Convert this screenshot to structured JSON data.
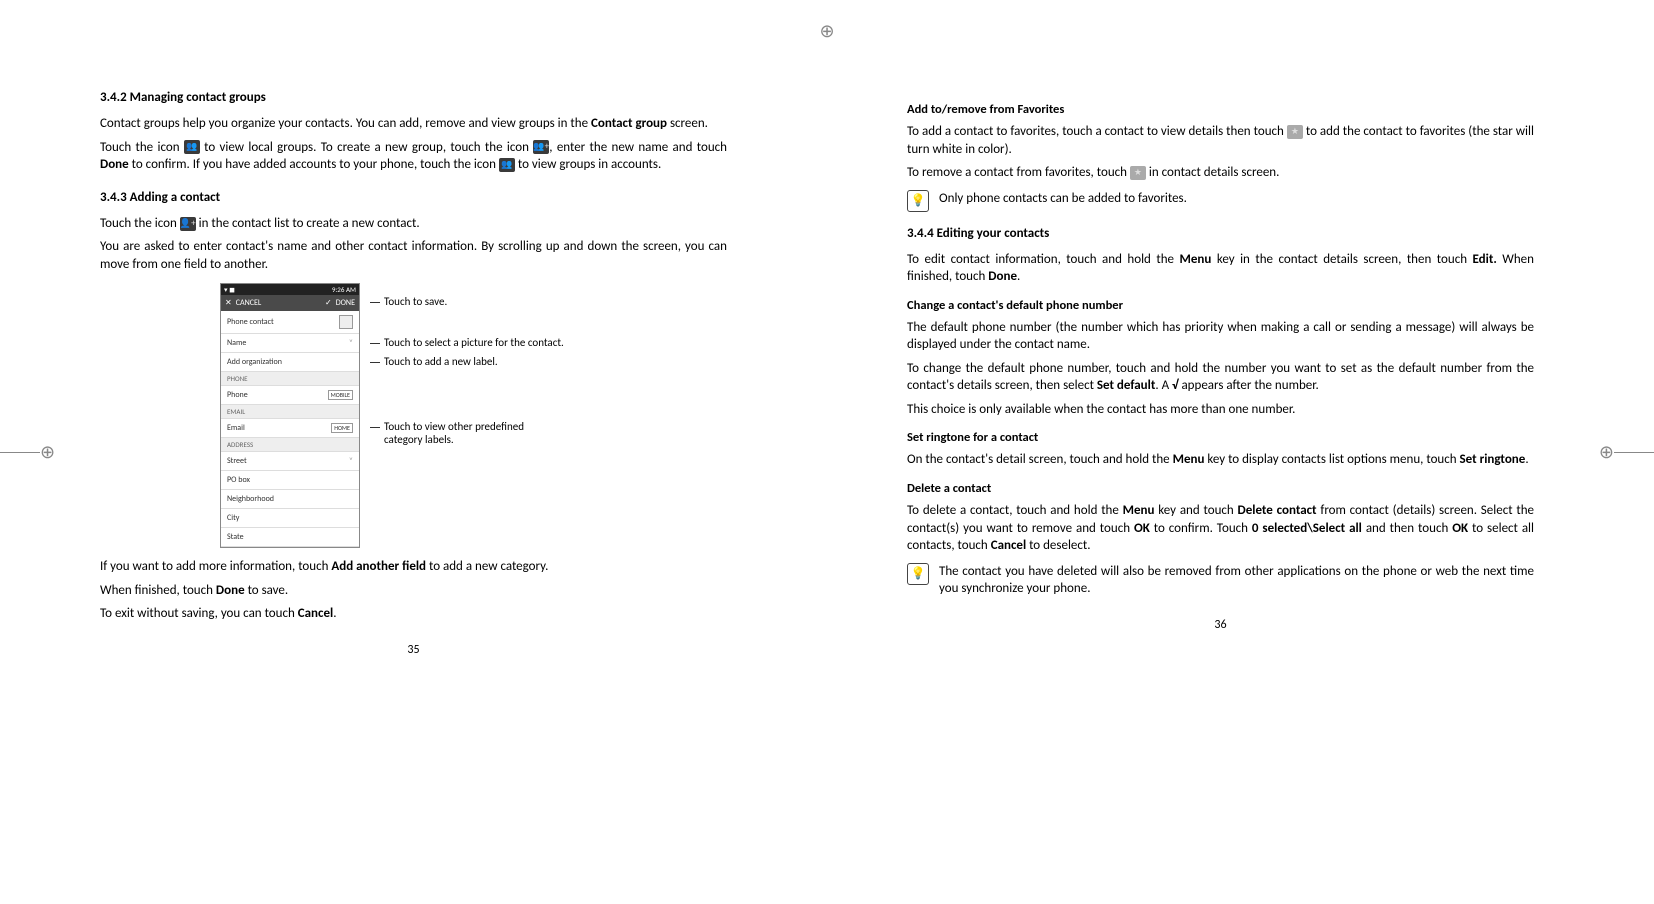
{
  "reg": {
    "top": "⊕",
    "bottom": "⊕",
    "left": "⊕",
    "right": "⊕"
  },
  "left": {
    "h342": "3.4.2   Managing contact groups",
    "p1a": "Contact groups help you organize your contacts. You can add, remove and view groups in the ",
    "p1b": "Contact group",
    "p1c": " screen.",
    "p2a": "Touch the icon ",
    "p2b": " to view local groups. To create a new group, touch the icon ",
    "p2c": ", enter the new name and touch ",
    "p2d": "Done",
    "p2e": " to confirm. If you have added accounts to your phone, touch the icon ",
    "p2f": " to view groups in accounts.",
    "h343": "3.4.3   Adding a contact",
    "p3a": "Touch the icon ",
    "p3b": " in the contact list to create a new contact.",
    "p4": "You are asked to enter contact's name and other contact information. By scrolling up and down the screen, you can move from one field to another.",
    "phone": {
      "status_time": "9:26 AM",
      "cancel": "CANCEL",
      "done": "DONE",
      "acct": "Phone contact",
      "name": "Name",
      "addorg": "Add organization",
      "sec_phone": "PHONE",
      "phone_lbl": "Phone",
      "phone_type": "MOBILE",
      "sec_email": "EMAIL",
      "email_lbl": "Email",
      "email_type": "HOME",
      "sec_addr": "ADDRESS",
      "street": "Street",
      "pobox": "PO box",
      "neigh": "Neighborhood",
      "city": "City",
      "state": "State"
    },
    "co_save": "Touch to save.",
    "co_pic": "Touch to select a picture for the contact.",
    "co_label": "Touch to add a new label.",
    "co_cat1": "Touch to view other predefined",
    "co_cat2": "category labels.",
    "p5a": "If you want to add more information, touch ",
    "p5b": "Add another field",
    "p5c": " to add a new category.",
    "p6a": "When finished, touch ",
    "p6b": "Done",
    "p6c": " to save.",
    "p7a": "To exit without saving, you can touch ",
    "p7b": "Cancel",
    "p7c": ".",
    "pagenum": "35"
  },
  "right": {
    "hfav": "Add to/remove from Favorites",
    "pfav1a": "To add a contact to favorites, touch a contact to view details then touch ",
    "pfav1b": " to add the contact to favorites (the star will turn white in color).",
    "pfav2a": "To remove a contact from favorites, touch ",
    "pfav2b": " in contact details screen.",
    "note1": "Only phone contacts can be added to favorites.",
    "h344": "3.4.4   Editing your contacts",
    "pedit_a": "To edit contact information, touch and hold the ",
    "pedit_b": "Menu",
    "pedit_c": " key in the contact details screen, then touch ",
    "pedit_d": "Edit.",
    "pedit_e": " When finished, touch ",
    "pedit_f": "Done",
    "pedit_g": ".",
    "hdef": "Change a contact's default phone number",
    "pdef1": "The default phone number (the number which has priority when making a call or sending a message) will always be displayed under the contact name.",
    "pdef2a": "To change the default phone number, touch and hold the number you want to set as the default number from the contact's details screen, then select ",
    "pdef2b": "Set default",
    "pdef2c": ". A ",
    "pdef2d": "√",
    "pdef2e": " appears after the number.",
    "pdef3": "This choice is only available when the contact has more than one number.",
    "hring": "Set ringtone for a contact",
    "pring_a": "On the contact's detail screen, touch and hold the ",
    "pring_b": "Menu",
    "pring_c": " key to display contacts list options menu, touch ",
    "pring_d": "Set ringtone",
    "pring_e": ".",
    "hdel": "Delete a contact",
    "pdel_a": "To delete a contact, touch and hold the ",
    "pdel_b": "Menu",
    "pdel_c": " key and touch ",
    "pdel_d": "Delete contact",
    "pdel_e": " from contact (details) screen. Select the contact(s) you want to remove and touch ",
    "pdel_f": "OK",
    "pdel_g": " to confirm. Touch ",
    "pdel_h": "0 selected\\Select all",
    "pdel_i": " and then touch ",
    "pdel_j": "OK",
    "pdel_k": " to select all contacts, touch ",
    "pdel_l": "Cancel",
    "pdel_m": " to deselect.",
    "note2": "The contact you have deleted will also be removed from other applications on the phone or web the next time you synchronize your phone.",
    "pagenum": "36"
  }
}
